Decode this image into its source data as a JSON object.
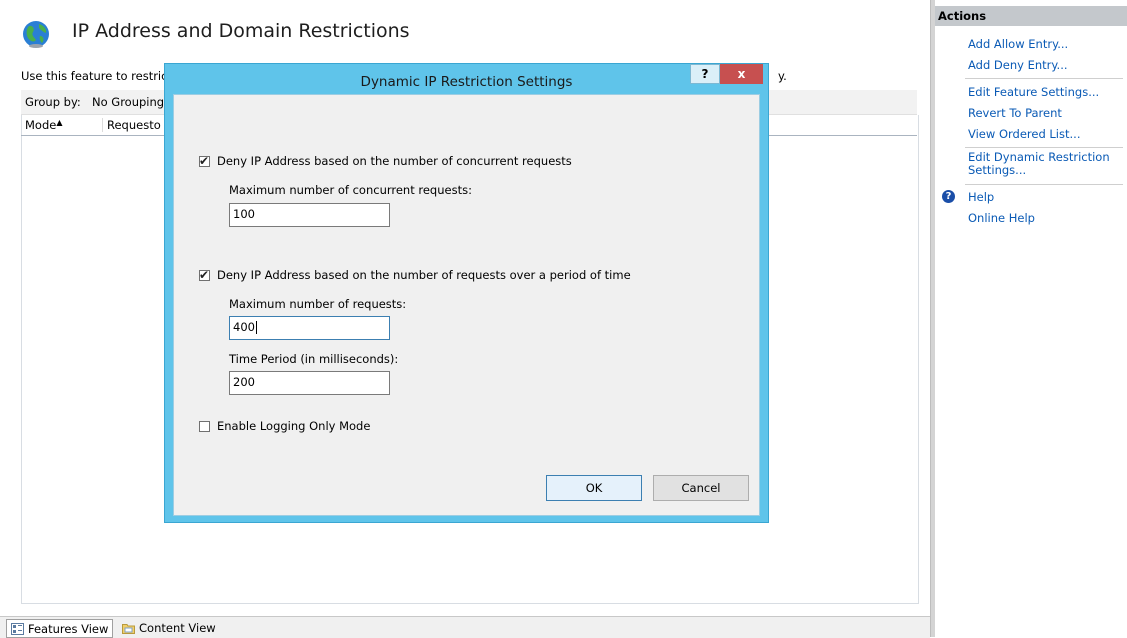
{
  "page": {
    "title": "IP Address and Domain Restrictions",
    "description": "Use this feature to restrict",
    "description_tail": "y.",
    "group_by_label": "Group by:",
    "group_by_value": "No Grouping",
    "columns": [
      "Mode",
      "Requesto"
    ]
  },
  "dialog": {
    "title": "Dynamic IP Restriction Settings",
    "help_button": "?",
    "close_button": "x",
    "concurrent": {
      "checkbox_label": "Deny IP Address based on the number of concurrent requests",
      "checked": true,
      "max_label": "Maximum number of concurrent requests:",
      "max_value": "100"
    },
    "rate": {
      "checkbox_label": "Deny IP Address based on the number of requests over a period of time",
      "checked": true,
      "max_label": "Maximum number of requests:",
      "max_value": "400",
      "period_label": "Time Period (in milliseconds):",
      "period_value": "200"
    },
    "logging": {
      "checkbox_label": "Enable Logging Only Mode",
      "checked": false
    },
    "ok_label": "OK",
    "cancel_label": "Cancel"
  },
  "actions": {
    "header": "Actions",
    "items": [
      "Add Allow Entry...",
      "Add Deny Entry...",
      "Edit Feature Settings...",
      "Revert To Parent",
      "View Ordered List...",
      "Edit Dynamic Restriction Settings...",
      "Help",
      "Online Help"
    ]
  },
  "bottom_tabs": {
    "features_view": "Features View",
    "content_view": "Content View"
  },
  "colors": {
    "dialog_frame": "#5fc4ea",
    "link": "#0a5ab5",
    "close_button": "#c75050"
  }
}
